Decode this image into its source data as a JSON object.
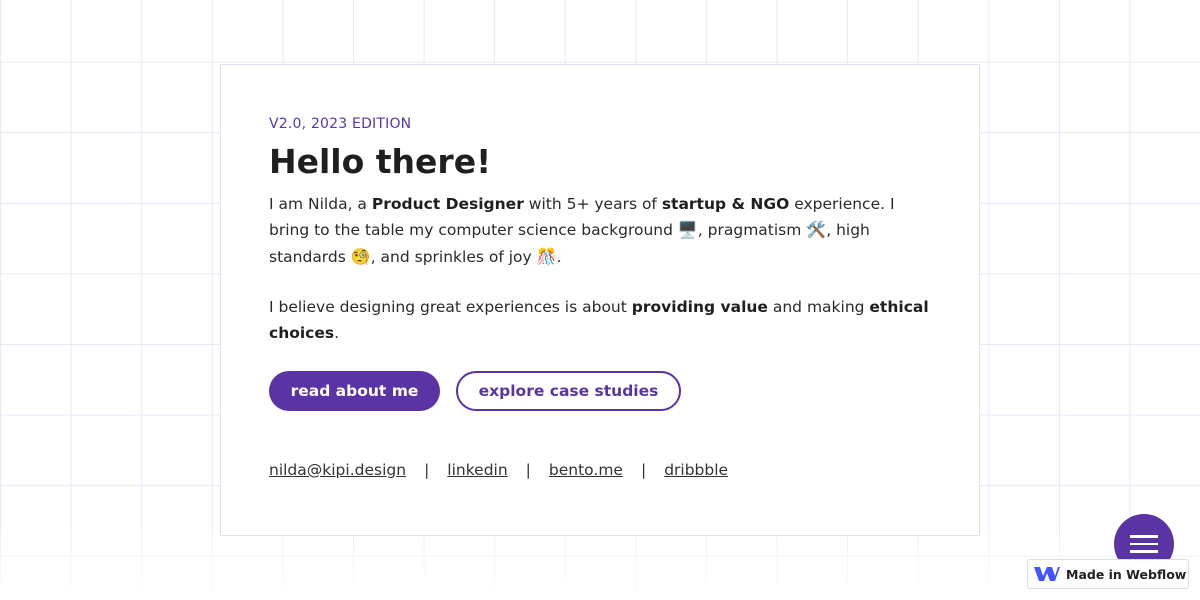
{
  "hero": {
    "edition": "V2.0, 2023 EDITION",
    "title": "Hello there!",
    "p1_a": "I am Nilda, a ",
    "p1_b": "Product Designer",
    "p1_c": " with 5+ years of ",
    "p1_d": "startup & NGO",
    "p1_e": " experience. I bring to the table my computer science background ",
    "p1_f": ", pragmatism ",
    "p1_g": ", high standards ",
    "p1_h": ", and sprinkles of joy ",
    "p1_i": ".",
    "p2_a": "I believe designing great experiences is about ",
    "p2_b": "providing value",
    "p2_c": " and making ",
    "p2_d": "ethical choices",
    "p2_e": "."
  },
  "emojis": {
    "computer": "🖥️",
    "tools": "🛠️",
    "monocle": "🧐",
    "confetti": "🎊"
  },
  "buttons": {
    "primary": "read about me",
    "secondary": "explore case studies"
  },
  "links": [
    {
      "label": "nilda@kipi.design"
    },
    {
      "label": "linkedin"
    },
    {
      "label": "bento.me"
    },
    {
      "label": "dribbble"
    }
  ],
  "separator": "|",
  "badge": {
    "label": "Made in Webflow"
  },
  "colors": {
    "accent": "#5a34a4",
    "grid": "#ece6f8"
  },
  "icons": {
    "menu": "hamburger-icon",
    "webflow": "webflow-logo-icon"
  }
}
